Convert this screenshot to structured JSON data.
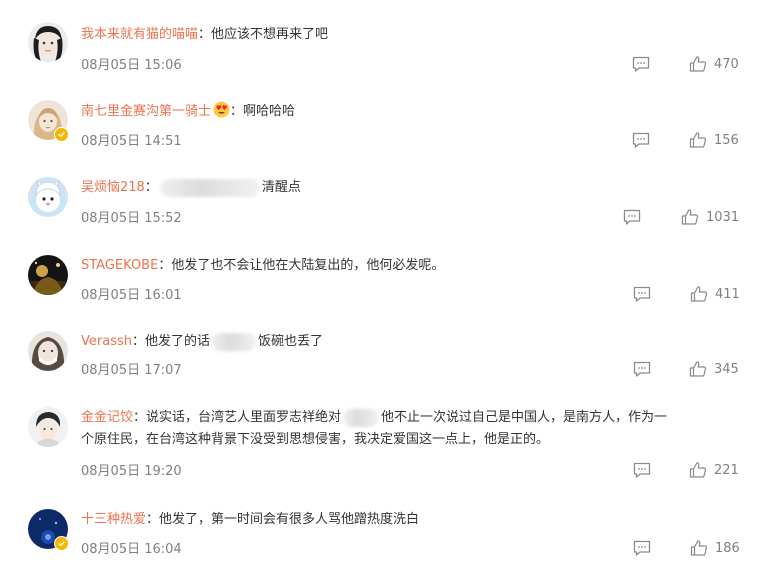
{
  "comments": [
    {
      "author": "我本来就有猫的喵喵",
      "text": "他应该不想再来了吧",
      "time": "08月05日 15:06",
      "likes": "470",
      "avatar_color": "#e8e8e8"
    },
    {
      "author": "南七里金赛沟第一骑士",
      "text": "啊哈哈哈",
      "time": "08月05日 14:51",
      "likes": "156",
      "verified": true,
      "emoji": "heart-eyes-emoji"
    },
    {
      "author": "吴烦恼218",
      "text_after": "清醒点",
      "time": "08月05日 15:52",
      "likes": "1031"
    },
    {
      "author": "STAGEKOBE",
      "text": "他发了也不会让他在大陆复出的，他何必发呢。",
      "time": "08月05日 16:01",
      "likes": "411"
    },
    {
      "author": "Verassh",
      "text_before": "他发了的话",
      "text_after": "饭碗也丢了",
      "time": "08月05日 17:07",
      "likes": "345"
    },
    {
      "author": "金金记饺",
      "text_before": "说实话，台湾艺人里面罗志祥绝对",
      "text_after": "他不止一次说过自己是中国人，是南方人，作为一",
      "text_line2": "个原住民，在台湾这种背景下没受到思想侵害，我决定爱国这一点上，他是正的。",
      "time": "08月05日 19:20",
      "likes": "221"
    },
    {
      "author": "十三种热爱",
      "text": "他发了，第一时间会有很多人骂他蹭热度洗白",
      "time": "08月05日 16:04",
      "likes": "186",
      "verified": true
    }
  ],
  "separator": "：",
  "colors": {
    "author": "#eb7350",
    "text": "#333333",
    "meta": "#808080",
    "badge": "#f5b700"
  },
  "icons": {
    "reply": "comment-icon",
    "like": "thumbs-up-icon",
    "verified": "verified-badge-icon"
  }
}
